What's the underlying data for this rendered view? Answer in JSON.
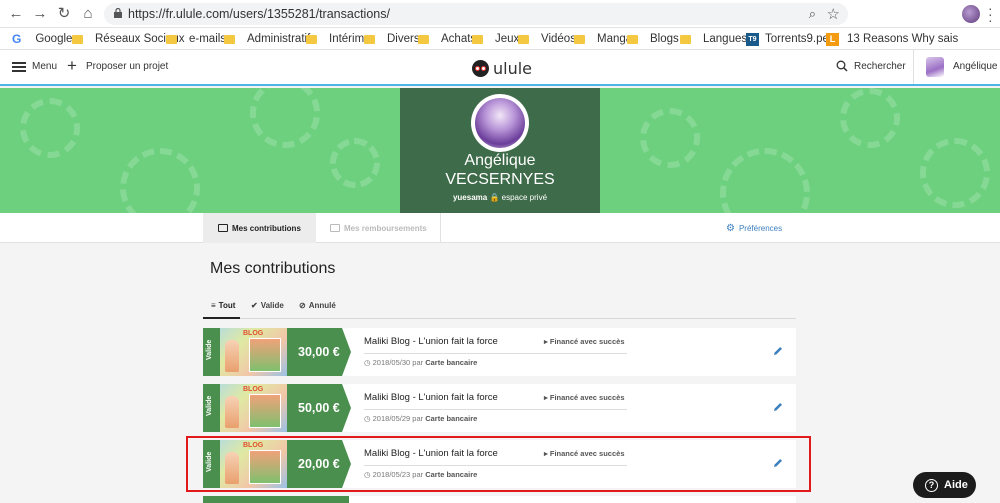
{
  "browser": {
    "url": "https://fr.ulule.com/users/1355281/transactions/",
    "bookmarks": [
      "Google",
      "Réseaux Sociaux",
      "e-mails",
      "Administratif",
      "Intérim",
      "Divers",
      "Achats",
      "Jeux",
      "Vidéos",
      "Mangas",
      "Blogs",
      "Langues",
      "Torrents9.pe",
      "13 Reasons Why sais"
    ]
  },
  "header": {
    "menu_label": "Menu",
    "propose_label": "Proposer un projet",
    "logo_text": "ulule",
    "search_label": "Rechercher",
    "user_label": "Angélique"
  },
  "profile": {
    "first_name": "Angélique",
    "last_name": "VECSERNYES",
    "username": "yuesama",
    "private_label": "espace privé"
  },
  "tabs": {
    "contributions": "Mes contributions",
    "refunds": "Mes remboursements",
    "preferences": "Préférences"
  },
  "page_title": "Mes contributions",
  "filters": [
    "Tout",
    "Valide",
    "Annulé"
  ],
  "contributions": [
    {
      "status_ribbon": "Valide",
      "amount": "30,00 €",
      "project": "Maliki Blog - L'union fait la force",
      "project_status": "Financé avec succès",
      "date": "2018/05/30",
      "by": "par",
      "method": "Carte bancaire"
    },
    {
      "status_ribbon": "Valide",
      "amount": "50,00 €",
      "project": "Maliki Blog - L'union fait la force",
      "project_status": "Financé avec succès",
      "date": "2018/05/29",
      "by": "par",
      "method": "Carte bancaire"
    },
    {
      "status_ribbon": "Valide",
      "amount": "20,00 €",
      "project": "Maliki Blog - L'union fait la force",
      "project_status": "Financé avec succès",
      "date": "2018/05/23",
      "by": "par",
      "method": "Carte bancaire"
    }
  ],
  "help_button": "Aide",
  "thumb_blog_label": "BLOG",
  "colors": {
    "brand_green": "#4a8f4e",
    "banner_green": "#6cd07e",
    "profile_box": "#3e6b49",
    "highlight_red": "#e1191a",
    "link_blue": "#3c7fbf"
  }
}
